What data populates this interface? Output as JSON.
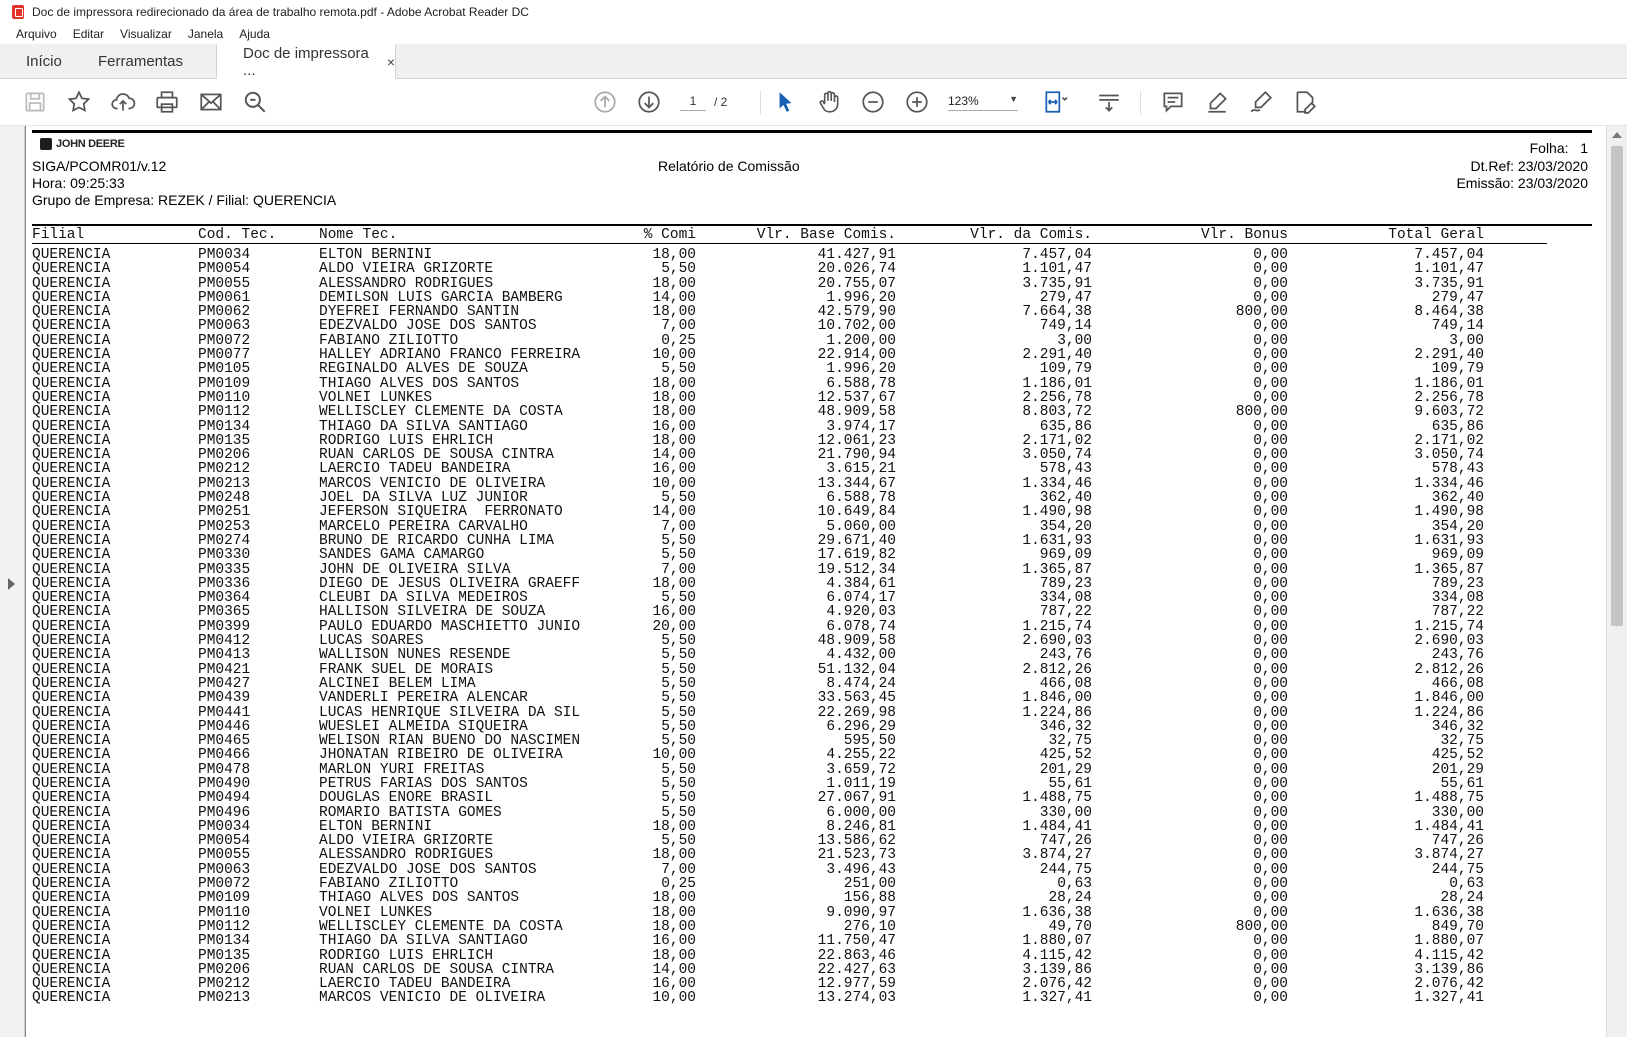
{
  "window": {
    "title": "Doc de impressora redirecionado da área de trabalho remota.pdf - Adobe Acrobat Reader DC"
  },
  "menu": [
    "Arquivo",
    "Editar",
    "Visualizar",
    "Janela",
    "Ajuda"
  ],
  "tabs": {
    "home": "Início",
    "tools": "Ferramentas",
    "doc": "Doc de impressora ...",
    "close": "×"
  },
  "toolbar": {
    "page_current": "1",
    "page_total": "/ 2",
    "zoom": "123%"
  },
  "report": {
    "logo": "JOHN DEERE",
    "folha_label": "Folha:",
    "folha_value": "1",
    "code": "SIGA/PCOMR01/v.12",
    "title": "Relatório de Comissão",
    "dtref": "Dt.Ref: 23/03/2020",
    "hora": "Hora: 09:25:33",
    "emissao": "Emissão: 23/03/2020",
    "grupo": "Grupo de Empresa: REZEK / Filial: QUERENCIA",
    "columns": [
      "Filial",
      "Cod. Tec.",
      "Nome Tec.",
      "% Comi",
      "Vlr. Base Comis.",
      "Vlr. da Comis.",
      "Vlr. Bonus",
      "Total Geral"
    ],
    "rows": [
      [
        "QUERENCIA",
        "PM0034",
        "ELTON BERNINI",
        "18,00",
        "41.427,91",
        "7.457,04",
        "0,00",
        "7.457,04"
      ],
      [
        "QUERENCIA",
        "PM0054",
        "ALDO VIEIRA GRIZORTE",
        "5,50",
        "20.026,74",
        "1.101,47",
        "0,00",
        "1.101,47"
      ],
      [
        "QUERENCIA",
        "PM0055",
        "ALESSANDRO RODRIGUES",
        "18,00",
        "20.755,07",
        "3.735,91",
        "0,00",
        "3.735,91"
      ],
      [
        "QUERENCIA",
        "PM0061",
        "DEMILSON LUIS GARCIA BAMBERG",
        "14,00",
        "1.996,20",
        "279,47",
        "0,00",
        "279,47"
      ],
      [
        "QUERENCIA",
        "PM0062",
        "DYEFREI FERNANDO SANTIN",
        "18,00",
        "42.579,90",
        "7.664,38",
        "800,00",
        "8.464,38"
      ],
      [
        "QUERENCIA",
        "PM0063",
        "EDEZVALDO JOSE DOS SANTOS",
        "7,00",
        "10.702,00",
        "749,14",
        "0,00",
        "749,14"
      ],
      [
        "QUERENCIA",
        "PM0072",
        "FABIANO ZILIOTTO",
        "0,25",
        "1.200,00",
        "3,00",
        "0,00",
        "3,00"
      ],
      [
        "QUERENCIA",
        "PM0077",
        "HALLEY ADRIANO FRANCO FERREIRA",
        "10,00",
        "22.914,00",
        "2.291,40",
        "0,00",
        "2.291,40"
      ],
      [
        "QUERENCIA",
        "PM0105",
        "REGINALDO ALVES DE SOUZA",
        "5,50",
        "1.996,20",
        "109,79",
        "0,00",
        "109,79"
      ],
      [
        "QUERENCIA",
        "PM0109",
        "THIAGO ALVES DOS SANTOS",
        "18,00",
        "6.588,78",
        "1.186,01",
        "0,00",
        "1.186,01"
      ],
      [
        "QUERENCIA",
        "PM0110",
        "VOLNEI LUNKES",
        "18,00",
        "12.537,67",
        "2.256,78",
        "0,00",
        "2.256,78"
      ],
      [
        "QUERENCIA",
        "PM0112",
        "WELLISCLEY CLEMENTE DA COSTA",
        "18,00",
        "48.909,58",
        "8.803,72",
        "800,00",
        "9.603,72"
      ],
      [
        "QUERENCIA",
        "PM0134",
        "THIAGO DA SILVA SANTIAGO",
        "16,00",
        "3.974,17",
        "635,86",
        "0,00",
        "635,86"
      ],
      [
        "QUERENCIA",
        "PM0135",
        "RODRIGO LUIS EHRLICH",
        "18,00",
        "12.061,23",
        "2.171,02",
        "0,00",
        "2.171,02"
      ],
      [
        "QUERENCIA",
        "PM0206",
        "RUAN CARLOS DE SOUSA CINTRA",
        "14,00",
        "21.790,94",
        "3.050,74",
        "0,00",
        "3.050,74"
      ],
      [
        "QUERENCIA",
        "PM0212",
        "LAERCIO TADEU BANDEIRA",
        "16,00",
        "3.615,21",
        "578,43",
        "0,00",
        "578,43"
      ],
      [
        "QUERENCIA",
        "PM0213",
        "MARCOS VENICIO DE OLIVEIRA",
        "10,00",
        "13.344,67",
        "1.334,46",
        "0,00",
        "1.334,46"
      ],
      [
        "QUERENCIA",
        "PM0248",
        "JOEL DA SILVA LUZ JUNIOR",
        "5,50",
        "6.588,78",
        "362,40",
        "0,00",
        "362,40"
      ],
      [
        "QUERENCIA",
        "PM0251",
        "JEFERSON SIQUEIRA  FERRONATO",
        "14,00",
        "10.649,84",
        "1.490,98",
        "0,00",
        "1.490,98"
      ],
      [
        "QUERENCIA",
        "PM0253",
        "MARCELO PEREIRA CARVALHO",
        "7,00",
        "5.060,00",
        "354,20",
        "0,00",
        "354,20"
      ],
      [
        "QUERENCIA",
        "PM0274",
        "BRUNO DE RICARDO CUNHA LIMA",
        "5,50",
        "29.671,40",
        "1.631,93",
        "0,00",
        "1.631,93"
      ],
      [
        "QUERENCIA",
        "PM0330",
        "SANDES GAMA CAMARGO",
        "5,50",
        "17.619,82",
        "969,09",
        "0,00",
        "969,09"
      ],
      [
        "QUERENCIA",
        "PM0335",
        "JOHN DE OLIVEIRA SILVA",
        "7,00",
        "19.512,34",
        "1.365,87",
        "0,00",
        "1.365,87"
      ],
      [
        "QUERENCIA",
        "PM0336",
        "DIEGO DE JESUS OLIVEIRA GRAEFF",
        "18,00",
        "4.384,61",
        "789,23",
        "0,00",
        "789,23"
      ],
      [
        "QUERENCIA",
        "PM0364",
        "CLEUBI DA SILVA MEDEIROS",
        "5,50",
        "6.074,17",
        "334,08",
        "0,00",
        "334,08"
      ],
      [
        "QUERENCIA",
        "PM0365",
        "HALLISON SILVEIRA DE SOUZA",
        "16,00",
        "4.920,03",
        "787,22",
        "0,00",
        "787,22"
      ],
      [
        "QUERENCIA",
        "PM0399",
        "PAULO EDUARDO MASCHIETTO JUNIO",
        "20,00",
        "6.078,74",
        "1.215,74",
        "0,00",
        "1.215,74"
      ],
      [
        "QUERENCIA",
        "PM0412",
        "LUCAS SOARES",
        "5,50",
        "48.909,58",
        "2.690,03",
        "0,00",
        "2.690,03"
      ],
      [
        "QUERENCIA",
        "PM0413",
        "WALLISON NUNES RESENDE",
        "5,50",
        "4.432,00",
        "243,76",
        "0,00",
        "243,76"
      ],
      [
        "QUERENCIA",
        "PM0421",
        "FRANK SUEL DE MORAIS",
        "5,50",
        "51.132,04",
        "2.812,26",
        "0,00",
        "2.812,26"
      ],
      [
        "QUERENCIA",
        "PM0427",
        "ALCINEI BELEM LIMA",
        "5,50",
        "8.474,24",
        "466,08",
        "0,00",
        "466,08"
      ],
      [
        "QUERENCIA",
        "PM0439",
        "VANDERLI PEREIRA ALENCAR",
        "5,50",
        "33.563,45",
        "1.846,00",
        "0,00",
        "1.846,00"
      ],
      [
        "QUERENCIA",
        "PM0441",
        "LUCAS HENRIQUE SILVEIRA DA SIL",
        "5,50",
        "22.269,98",
        "1.224,86",
        "0,00",
        "1.224,86"
      ],
      [
        "QUERENCIA",
        "PM0446",
        "WUESLEI ALMEIDA SIQUEIRA",
        "5,50",
        "6.296,29",
        "346,32",
        "0,00",
        "346,32"
      ],
      [
        "QUERENCIA",
        "PM0465",
        "WELISON RIAN BUENO DO NASCIMEN",
        "5,50",
        "595,50",
        "32,75",
        "0,00",
        "32,75"
      ],
      [
        "QUERENCIA",
        "PM0466",
        "JHONATAN RIBEIRO DE OLIVEIRA",
        "10,00",
        "4.255,22",
        "425,52",
        "0,00",
        "425,52"
      ],
      [
        "QUERENCIA",
        "PM0478",
        "MARLON YURI FREITAS",
        "5,50",
        "3.659,72",
        "201,29",
        "0,00",
        "201,29"
      ],
      [
        "QUERENCIA",
        "PM0490",
        "PETRUS FARIAS DOS SANTOS",
        "5,50",
        "1.011,19",
        "55,61",
        "0,00",
        "55,61"
      ],
      [
        "QUERENCIA",
        "PM0494",
        "DOUGLAS ENORE BRASIL",
        "5,50",
        "27.067,91",
        "1.488,75",
        "0,00",
        "1.488,75"
      ],
      [
        "QUERENCIA",
        "PM0496",
        "ROMARIO BATISTA GOMES",
        "5,50",
        "6.000,00",
        "330,00",
        "0,00",
        "330,00"
      ],
      [
        "QUERENCIA",
        "PM0034",
        "ELTON BERNINI",
        "18,00",
        "8.246,81",
        "1.484,41",
        "0,00",
        "1.484,41"
      ],
      [
        "QUERENCIA",
        "PM0054",
        "ALDO VIEIRA GRIZORTE",
        "5,50",
        "13.586,62",
        "747,26",
        "0,00",
        "747,26"
      ],
      [
        "QUERENCIA",
        "PM0055",
        "ALESSANDRO RODRIGUES",
        "18,00",
        "21.523,73",
        "3.874,27",
        "0,00",
        "3.874,27"
      ],
      [
        "QUERENCIA",
        "PM0063",
        "EDEZVALDO JOSE DOS SANTOS",
        "7,00",
        "3.496,43",
        "244,75",
        "0,00",
        "244,75"
      ],
      [
        "QUERENCIA",
        "PM0072",
        "FABIANO ZILIOTTO",
        "0,25",
        "251,00",
        "0,63",
        "0,00",
        "0,63"
      ],
      [
        "QUERENCIA",
        "PM0109",
        "THIAGO ALVES DOS SANTOS",
        "18,00",
        "156,88",
        "28,24",
        "0,00",
        "28,24"
      ],
      [
        "QUERENCIA",
        "PM0110",
        "VOLNEI LUNKES",
        "18,00",
        "9.090,97",
        "1.636,38",
        "0,00",
        "1.636,38"
      ],
      [
        "QUERENCIA",
        "PM0112",
        "WELLISCLEY CLEMENTE DA COSTA",
        "18,00",
        "276,10",
        "49,70",
        "800,00",
        "849,70"
      ],
      [
        "QUERENCIA",
        "PM0134",
        "THIAGO DA SILVA SANTIAGO",
        "16,00",
        "11.750,47",
        "1.880,07",
        "0,00",
        "1.880,07"
      ],
      [
        "QUERENCIA",
        "PM0135",
        "RODRIGO LUIS EHRLICH",
        "18,00",
        "22.863,46",
        "4.115,42",
        "0,00",
        "4.115,42"
      ],
      [
        "QUERENCIA",
        "PM0206",
        "RUAN CARLOS DE SOUSA CINTRA",
        "14,00",
        "22.427,63",
        "3.139,86",
        "0,00",
        "3.139,86"
      ],
      [
        "QUERENCIA",
        "PM0212",
        "LAERCIO TADEU BANDEIRA",
        "16,00",
        "12.977,59",
        "2.076,42",
        "0,00",
        "2.076,42"
      ],
      [
        "QUERENCIA",
        "PM0213",
        "MARCOS VENICIO DE OLIVEIRA",
        "10,00",
        "13.274,03",
        "1.327,41",
        "0,00",
        "1.327,41"
      ]
    ]
  }
}
